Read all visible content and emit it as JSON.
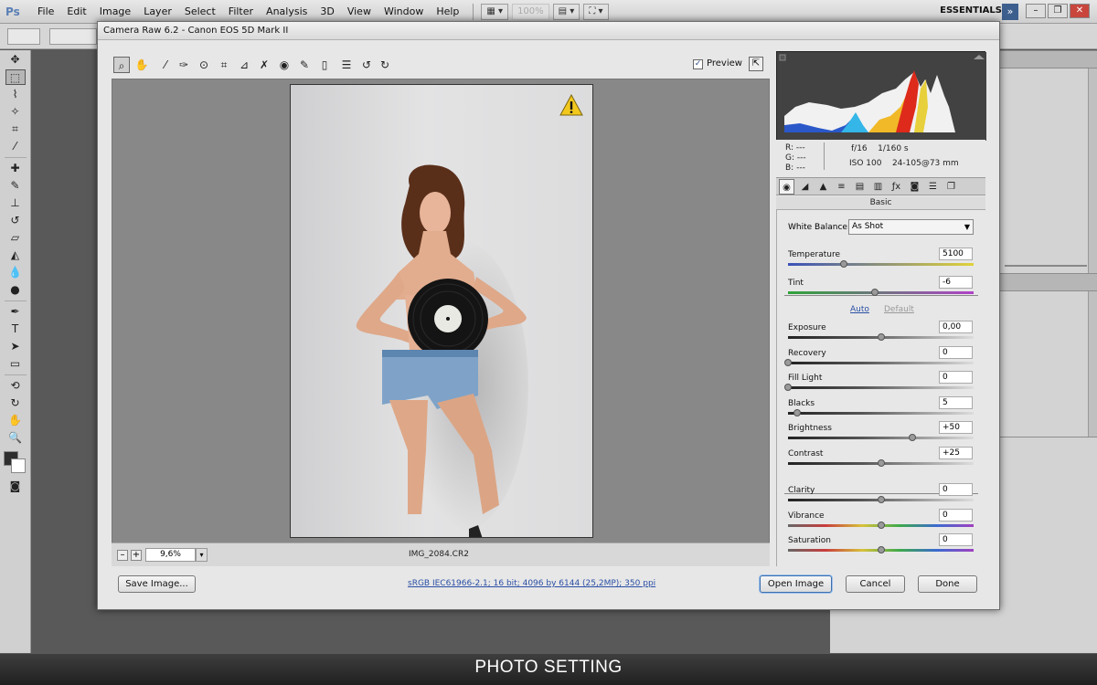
{
  "ps": {
    "logo": "Ps",
    "menus": [
      "File",
      "Edit",
      "Image",
      "Layer",
      "Select",
      "Filter",
      "Analysis",
      "3D",
      "View",
      "Window",
      "Help"
    ],
    "zoom": "100%",
    "workspace": "ESSENTIALS"
  },
  "dialog": {
    "title": "Camera Raw 6.2  -  Canon EOS 5D Mark II",
    "preview_label": "Preview",
    "preview_checked": true,
    "zoom_value": "9,6%",
    "filename": "IMG_2084.CR2",
    "info": {
      "r": "R:   ---",
      "g": "G:   ---",
      "b": "B:   ---",
      "aperture": "f/16",
      "shutter": "1/160 s",
      "iso": "ISO 100",
      "lens": "24-105@73 mm"
    },
    "panel_title": "Basic",
    "white_balance_label": "White Balance:",
    "white_balance_value": "As Shot",
    "auto_label": "Auto",
    "default_label": "Default",
    "sliders": [
      {
        "label": "Temperature",
        "value": "5100",
        "pos": 0.3
      },
      {
        "label": "Tint",
        "value": "-6",
        "pos": 0.47
      },
      {
        "label": "Exposure",
        "value": "0,00",
        "pos": 0.5
      },
      {
        "label": "Recovery",
        "value": "0",
        "pos": 0.0
      },
      {
        "label": "Fill Light",
        "value": "0",
        "pos": 0.0
      },
      {
        "label": "Blacks",
        "value": "5",
        "pos": 0.05
      },
      {
        "label": "Brightness",
        "value": "+50",
        "pos": 0.67
      },
      {
        "label": "Contrast",
        "value": "+25",
        "pos": 0.5
      },
      {
        "label": "Clarity",
        "value": "0",
        "pos": 0.5
      },
      {
        "label": "Vibrance",
        "value": "0",
        "pos": 0.5
      },
      {
        "label": "Saturation",
        "value": "0",
        "pos": 0.5
      }
    ],
    "workflow_link": "sRGB IEC61966-2.1; 16 bit; 4096 by 6144 (25,2MP); 350 ppi",
    "buttons": {
      "save": "Save Image...",
      "open": "Open Image",
      "cancel": "Cancel",
      "done": "Done"
    }
  },
  "caption": "PHOTO SETTING",
  "colors": {
    "temperature_track": [
      "#3a52b8",
      "#e0d23a"
    ],
    "tint_track": [
      "#2fa43a",
      "#b042c8"
    ]
  }
}
